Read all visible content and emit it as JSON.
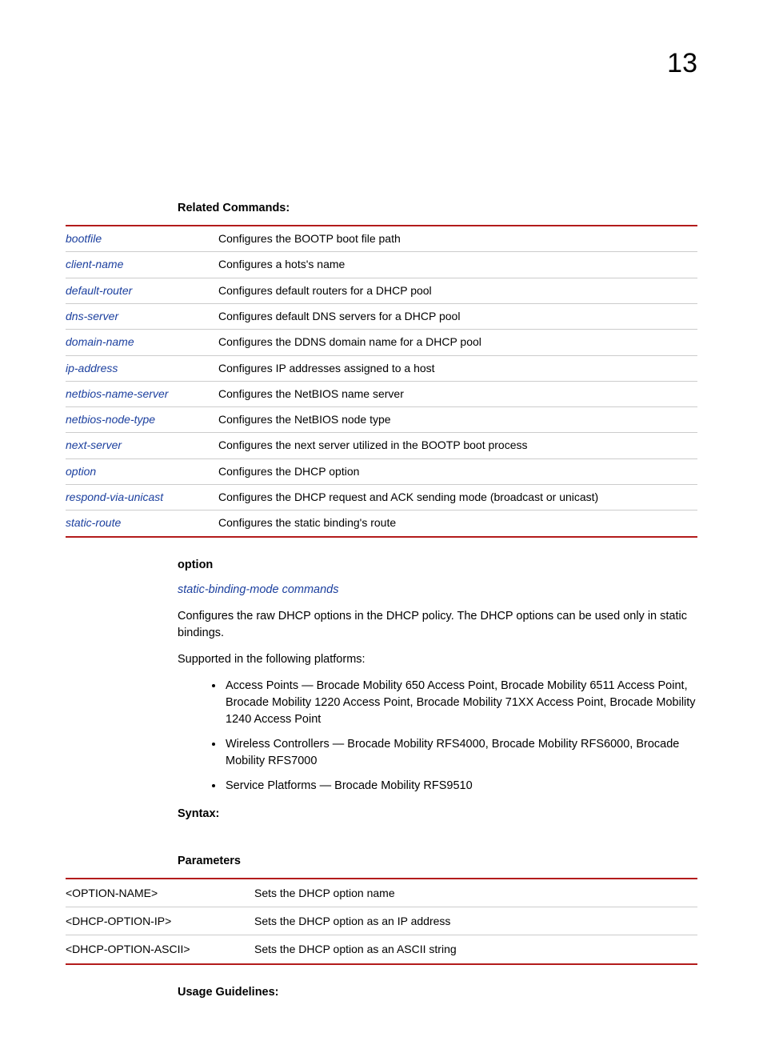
{
  "page_number": "13",
  "section_related": "Related Commands:",
  "related_commands": [
    {
      "cmd": "bootfile",
      "desc": "Configures the BOOTP boot file path"
    },
    {
      "cmd": "client-name",
      "desc": "Configures a hots's name"
    },
    {
      "cmd": "default-router",
      "desc": "Configures default routers for a DHCP pool"
    },
    {
      "cmd": "dns-server",
      "desc": "Configures default DNS servers for a DHCP pool"
    },
    {
      "cmd": "domain-name",
      "desc": "Configures the DDNS domain name for a DHCP pool"
    },
    {
      "cmd": "ip-address",
      "desc": "Configures IP addresses assigned to a host"
    },
    {
      "cmd": "netbios-name-server",
      "desc": "Configures the NetBIOS name server"
    },
    {
      "cmd": "netbios-node-type",
      "desc": "Configures the NetBIOS node type"
    },
    {
      "cmd": "next-server",
      "desc": "Configures the next server utilized in the BOOTP boot process"
    },
    {
      "cmd": "option",
      "desc": "Configures the DHCP option"
    },
    {
      "cmd": "respond-via-unicast",
      "desc": "Configures the DHCP request and ACK sending mode (broadcast or unicast)"
    },
    {
      "cmd": "static-route",
      "desc": "Configures the static binding's route"
    }
  ],
  "topic_heading": "option",
  "topic_sublink": "static-binding-mode commands",
  "topic_desc": "Configures the raw DHCP options in the DHCP policy. The DHCP options can be used only in static bindings.",
  "platforms_intro": "Supported in the following platforms:",
  "platforms": [
    "Access Points — Brocade Mobility 650 Access Point, Brocade Mobility 6511 Access Point, Brocade Mobility 1220 Access Point, Brocade Mobility 71XX Access Point, Brocade Mobility 1240 Access Point",
    "Wireless Controllers — Brocade Mobility RFS4000, Brocade Mobility RFS6000, Brocade Mobility RFS7000",
    "Service Platforms — Brocade Mobility RFS9510"
  ],
  "section_syntax": "Syntax:",
  "section_params": "Parameters",
  "params": [
    {
      "name": "<OPTION-NAME>",
      "desc": "Sets the DHCP option name"
    },
    {
      "name": "<DHCP-OPTION-IP>",
      "desc": "Sets the DHCP option as an IP address"
    },
    {
      "name": "<DHCP-OPTION-ASCII>",
      "desc": "Sets the DHCP option as an ASCII string"
    }
  ],
  "section_usage": "Usage Guidelines:"
}
